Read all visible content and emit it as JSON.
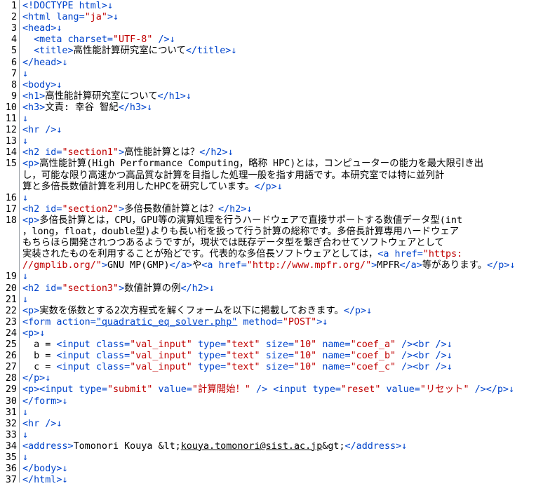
{
  "document": {
    "lines": [
      [
        [
          "t",
          "<!DOCTYPE html>"
        ],
        [
          "m",
          "↓"
        ]
      ],
      [
        [
          "t",
          "<html "
        ],
        [
          "a",
          "lang="
        ],
        [
          "v",
          "\"ja\""
        ],
        [
          "t",
          ">"
        ],
        [
          "m",
          "↓"
        ]
      ],
      [
        [
          "t",
          "<head>"
        ],
        [
          "m",
          "↓"
        ]
      ],
      [
        [
          "x",
          "  "
        ],
        [
          "t",
          "<meta "
        ],
        [
          "a",
          "charset="
        ],
        [
          "v",
          "\"UTF-8\""
        ],
        [
          "t",
          " />"
        ],
        [
          "m",
          "↓"
        ]
      ],
      [
        [
          "x",
          "  "
        ],
        [
          "t",
          "<title>"
        ],
        [
          "x",
          "高性能計算研究室について"
        ],
        [
          "t",
          "</title>"
        ],
        [
          "m",
          "↓"
        ]
      ],
      [
        [
          "t",
          "</head>"
        ],
        [
          "m",
          "↓"
        ]
      ],
      [
        [
          "m",
          "↓"
        ]
      ],
      [
        [
          "t",
          "<body>"
        ],
        [
          "m",
          "↓"
        ]
      ],
      [
        [
          "t",
          "<h1>"
        ],
        [
          "x",
          "高性能計算研究室について"
        ],
        [
          "t",
          "</h1>"
        ],
        [
          "m",
          "↓"
        ]
      ],
      [
        [
          "t",
          "<h3>"
        ],
        [
          "x",
          "文責: 幸谷 智紀"
        ],
        [
          "t",
          "</h3>"
        ],
        [
          "m",
          "↓"
        ]
      ],
      [
        [
          "m",
          "↓"
        ]
      ],
      [
        [
          "t",
          "<hr />"
        ],
        [
          "m",
          "↓"
        ]
      ],
      [
        [
          "m",
          "↓"
        ]
      ],
      [
        [
          "t",
          "<h2 "
        ],
        [
          "a",
          "id="
        ],
        [
          "v",
          "\"section1\""
        ],
        [
          "t",
          ">"
        ],
        [
          "x",
          "高性能計算とは？"
        ],
        [
          "t",
          "</h2>"
        ],
        [
          "m",
          "↓"
        ]
      ],
      [
        [
          "t",
          "<p>"
        ],
        [
          "x",
          "高性能計算(High Performance Computing，略称 HPC)とは，コンピューターの能力を最大限引き出"
        ]
      ],
      [
        [
          "x",
          "し，可能な限り高速かつ高品質な計算を目指した処理一般を指す用語です。本研究室では特に並列計"
        ]
      ],
      [
        [
          "x",
          "算と多倍長数値計算を利用したHPCを研究しています。"
        ],
        [
          "t",
          "</p>"
        ],
        [
          "m",
          "↓"
        ]
      ],
      [
        [
          "m",
          "↓"
        ]
      ],
      [
        [
          "t",
          "<h2 "
        ],
        [
          "a",
          "id="
        ],
        [
          "v",
          "\"section2\""
        ],
        [
          "t",
          ">"
        ],
        [
          "x",
          "多倍長数値計算とは？"
        ],
        [
          "t",
          "</h2>"
        ],
        [
          "m",
          "↓"
        ]
      ],
      [
        [
          "t",
          "<p>"
        ],
        [
          "x",
          "多倍長計算とは，CPU，GPU等の演算処理を行うハードウェアで直接サポートする数値データ型(int"
        ]
      ],
      [
        [
          "x",
          "，long，float，double型)よりも長い桁を扱って行う計算の総称です。多倍長計算専用ハードウェア"
        ]
      ],
      [
        [
          "x",
          "もちらほら開発されつつあるようですが，現状では既存データ型を繋ぎ合わせてソフトウェアとして"
        ]
      ],
      [
        [
          "x",
          "実装されたものを利用することが殆どです。代表的な多倍長ソフトウェアとしては，"
        ],
        [
          "t",
          "<a "
        ],
        [
          "a",
          "href="
        ],
        [
          "v",
          "\"https:"
        ]
      ],
      [
        [
          "v",
          "//gmplib.org/\""
        ],
        [
          "t",
          ">"
        ],
        [
          "x",
          "GNU MP(GMP)"
        ],
        [
          "t",
          "</a>"
        ],
        [
          "x",
          "や"
        ],
        [
          "t",
          "<a "
        ],
        [
          "a",
          "href="
        ],
        [
          "v",
          "\"http://www.mpfr.org/\""
        ],
        [
          "t",
          ">"
        ],
        [
          "x",
          "MPFR"
        ],
        [
          "t",
          "</a>"
        ],
        [
          "x",
          "等があります。"
        ],
        [
          "t",
          "</p>"
        ],
        [
          "m",
          "↓"
        ]
      ],
      [
        [
          "m",
          "↓"
        ]
      ],
      [
        [
          "t",
          "<h2 "
        ],
        [
          "a",
          "id="
        ],
        [
          "v",
          "\"section3\""
        ],
        [
          "t",
          ">"
        ],
        [
          "x",
          "数値計算の例"
        ],
        [
          "t",
          "</h2>"
        ],
        [
          "m",
          "↓"
        ]
      ],
      [
        [
          "m",
          "↓"
        ]
      ],
      [
        [
          "t",
          "<p>"
        ],
        [
          "x",
          "実数を係数とする2次方程式を解くフォームを以下に掲載しておきます。"
        ],
        [
          "t",
          "</p>"
        ],
        [
          "m",
          "↓"
        ]
      ],
      [
        [
          "t",
          "<form "
        ],
        [
          "a",
          "action="
        ],
        [
          "l",
          "\"quadratic_eq_solver.php\""
        ],
        [
          "x",
          " "
        ],
        [
          "a",
          "method="
        ],
        [
          "v",
          "\"POST\""
        ],
        [
          "t",
          ">"
        ],
        [
          "m",
          "↓"
        ]
      ],
      [
        [
          "t",
          "<p>"
        ],
        [
          "m",
          "↓"
        ]
      ],
      [
        [
          "x",
          "  a = "
        ],
        [
          "t",
          "<input "
        ],
        [
          "a",
          "class="
        ],
        [
          "v",
          "\"val_input\""
        ],
        [
          "x",
          " "
        ],
        [
          "a",
          "type="
        ],
        [
          "v",
          "\"text\""
        ],
        [
          "x",
          " "
        ],
        [
          "a",
          "size="
        ],
        [
          "v",
          "\"10\""
        ],
        [
          "x",
          " "
        ],
        [
          "a",
          "name="
        ],
        [
          "v",
          "\"coef_a\""
        ],
        [
          "t",
          " /><br />"
        ],
        [
          "m",
          "↓"
        ]
      ],
      [
        [
          "x",
          "  b = "
        ],
        [
          "t",
          "<input "
        ],
        [
          "a",
          "class="
        ],
        [
          "v",
          "\"val_input\""
        ],
        [
          "x",
          " "
        ],
        [
          "a",
          "type="
        ],
        [
          "v",
          "\"text\""
        ],
        [
          "x",
          " "
        ],
        [
          "a",
          "size="
        ],
        [
          "v",
          "\"10\""
        ],
        [
          "x",
          " "
        ],
        [
          "a",
          "name="
        ],
        [
          "v",
          "\"coef_b\""
        ],
        [
          "t",
          " /><br />"
        ],
        [
          "m",
          "↓"
        ]
      ],
      [
        [
          "x",
          "  c = "
        ],
        [
          "t",
          "<input "
        ],
        [
          "a",
          "class="
        ],
        [
          "v",
          "\"val_input\""
        ],
        [
          "x",
          " "
        ],
        [
          "a",
          "type="
        ],
        [
          "v",
          "\"text\""
        ],
        [
          "x",
          " "
        ],
        [
          "a",
          "size="
        ],
        [
          "v",
          "\"10\""
        ],
        [
          "x",
          " "
        ],
        [
          "a",
          "name="
        ],
        [
          "v",
          "\"coef_c\""
        ],
        [
          "t",
          " /><br />"
        ],
        [
          "m",
          "↓"
        ]
      ],
      [
        [
          "t",
          "</p>"
        ],
        [
          "m",
          "↓"
        ]
      ],
      [
        [
          "t",
          "<p><input "
        ],
        [
          "a",
          "type="
        ],
        [
          "v",
          "\"submit\""
        ],
        [
          "x",
          " "
        ],
        [
          "a",
          "value="
        ],
        [
          "v",
          "\"計算開始！\""
        ],
        [
          "t",
          " /> <input "
        ],
        [
          "a",
          "type="
        ],
        [
          "v",
          "\"reset\""
        ],
        [
          "x",
          " "
        ],
        [
          "a",
          "value="
        ],
        [
          "v",
          "\"リセット\""
        ],
        [
          "t",
          " /></p>"
        ],
        [
          "m",
          "↓"
        ]
      ],
      [
        [
          "t",
          "</form>"
        ],
        [
          "m",
          "↓"
        ]
      ],
      [
        [
          "m",
          "↓"
        ]
      ],
      [
        [
          "t",
          "<hr />"
        ],
        [
          "m",
          "↓"
        ]
      ],
      [
        [
          "m",
          "↓"
        ]
      ],
      [
        [
          "t",
          "<address>"
        ],
        [
          "x",
          "Tomonori Kouya &lt;"
        ],
        [
          "k",
          "kouya.tomonori@sist.ac.jp"
        ],
        [
          "x",
          "&gt;"
        ],
        [
          "t",
          "</address>"
        ],
        [
          "m",
          "↓"
        ]
      ],
      [
        [
          "m",
          "↓"
        ]
      ],
      [
        [
          "t",
          "</body>"
        ],
        [
          "m",
          "↓"
        ]
      ],
      [
        [
          "t",
          "</html>"
        ],
        [
          "m",
          "↓"
        ]
      ]
    ],
    "line_numbers": [
      "1",
      "2",
      "3",
      "4",
      "5",
      "6",
      "7",
      "8",
      "9",
      "10",
      "11",
      "12",
      "13",
      "14",
      "15",
      "",
      "",
      "16",
      "17",
      "18",
      "",
      "",
      "",
      "",
      "19",
      "20",
      "21",
      "22",
      "23",
      "24",
      "25",
      "26",
      "27",
      "28",
      "29",
      "30",
      "31",
      "32",
      "33",
      "34",
      "35",
      "36",
      "37"
    ]
  },
  "colors": {
    "tag": "#0044cc",
    "value": "#c00000",
    "text": "#000000",
    "gutter_border": "#9aa0a6"
  }
}
